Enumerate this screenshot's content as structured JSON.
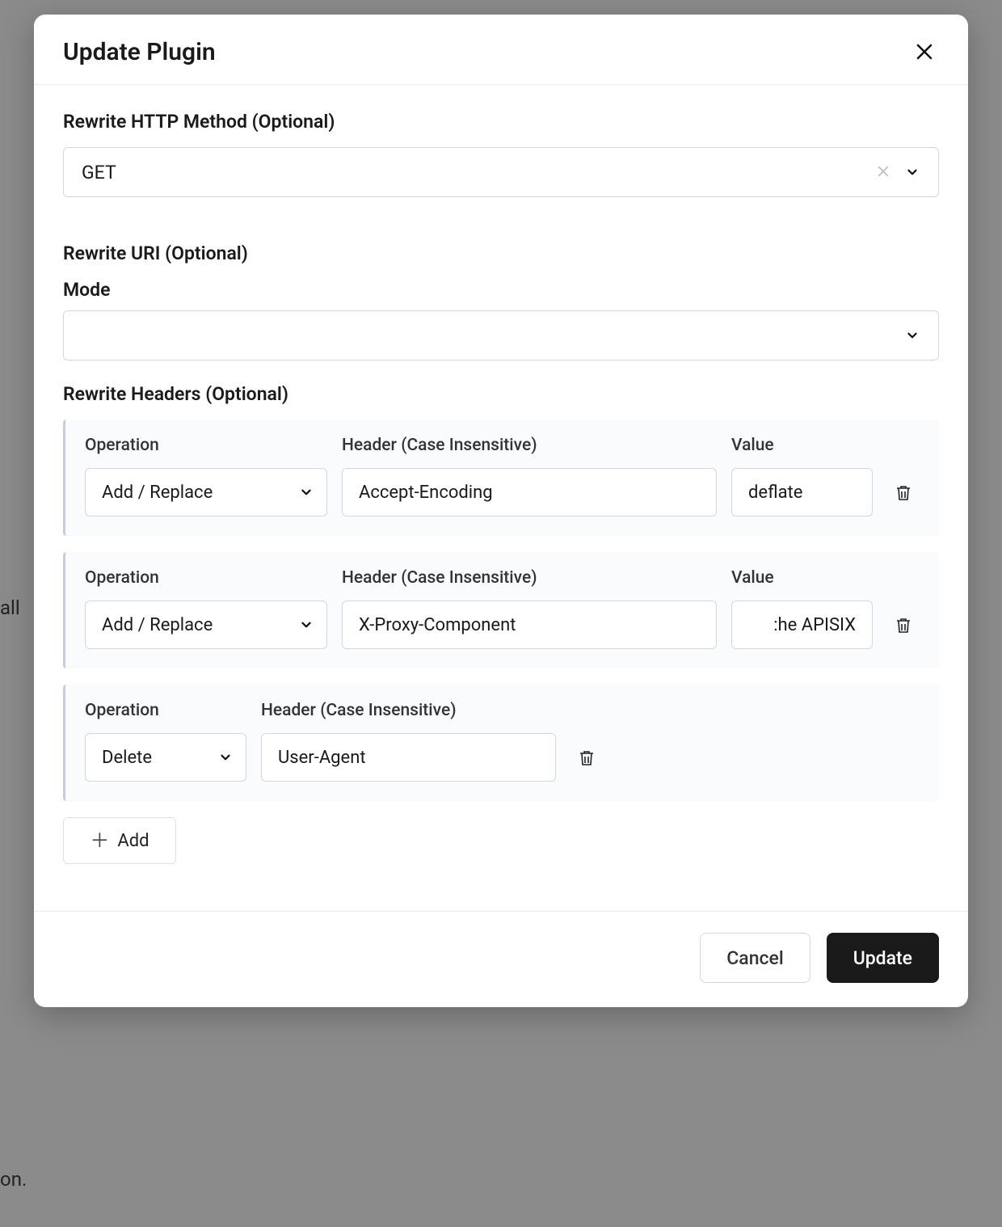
{
  "background": {
    "text1": "all",
    "text2": "on."
  },
  "modal": {
    "title": "Update Plugin",
    "sections": {
      "method_label": "Rewrite HTTP Method (Optional)",
      "method_value": "GET",
      "uri_label": "Rewrite URI (Optional)",
      "mode_label": "Mode",
      "mode_value": "",
      "headers_label": "Rewrite Headers (Optional)"
    },
    "column_labels": {
      "operation": "Operation",
      "header": "Header (Case Insensitive)",
      "value": "Value"
    },
    "header_rows": [
      {
        "operation": "Add / Replace",
        "header": "Accept-Encoding",
        "value": "deflate",
        "has_value": true
      },
      {
        "operation": "Add / Replace",
        "header": "X-Proxy-Component",
        "value": ":he APISIX",
        "has_value": true,
        "value_align_right": true
      },
      {
        "operation": "Delete",
        "header": "User-Agent",
        "value": "",
        "has_value": false
      }
    ],
    "add_label": "Add",
    "footer": {
      "cancel": "Cancel",
      "update": "Update"
    }
  }
}
